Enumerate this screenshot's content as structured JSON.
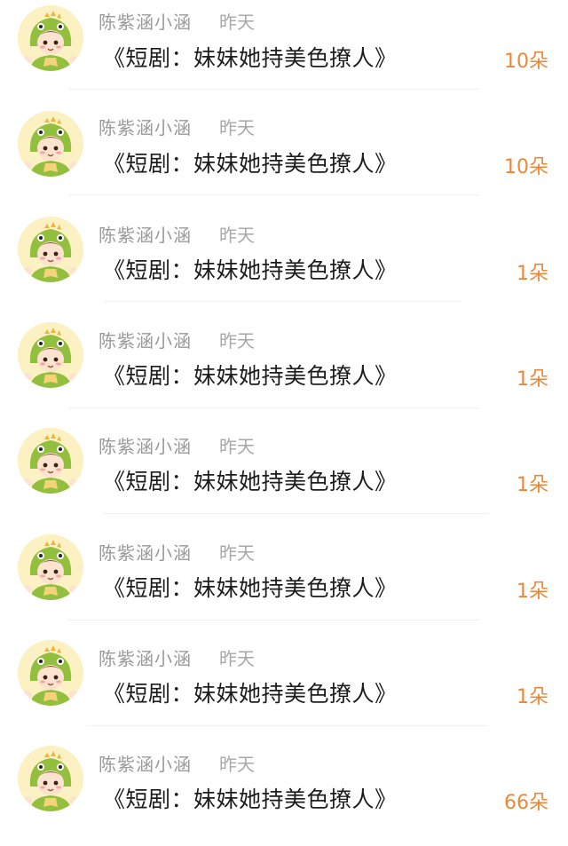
{
  "accent_color": "#e8893a",
  "items": [
    {
      "username": "陈紫涵小涵",
      "time": "昨天",
      "title": "《短剧：妹妹她持美色撩人》",
      "count": "10朵",
      "avatar_icon": "dinosaur-costume-avatar"
    },
    {
      "username": "陈紫涵小涵",
      "time": "昨天",
      "title": "《短剧：妹妹她持美色撩人》",
      "count": "10朵",
      "avatar_icon": "dinosaur-costume-avatar"
    },
    {
      "username": "陈紫涵小涵",
      "time": "昨天",
      "title": "《短剧：妹妹她持美色撩人》",
      "count": "1朵",
      "avatar_icon": "dinosaur-costume-avatar"
    },
    {
      "username": "陈紫涵小涵",
      "time": "昨天",
      "title": "《短剧：妹妹她持美色撩人》",
      "count": "1朵",
      "avatar_icon": "dinosaur-costume-avatar"
    },
    {
      "username": "陈紫涵小涵",
      "time": "昨天",
      "title": "《短剧：妹妹她持美色撩人》",
      "count": "1朵",
      "avatar_icon": "dinosaur-costume-avatar"
    },
    {
      "username": "陈紫涵小涵",
      "time": "昨天",
      "title": "《短剧：妹妹她持美色撩人》",
      "count": "1朵",
      "avatar_icon": "dinosaur-costume-avatar"
    },
    {
      "username": "陈紫涵小涵",
      "time": "昨天",
      "title": "《短剧：妹妹她持美色撩人》",
      "count": "1朵",
      "avatar_icon": "dinosaur-costume-avatar"
    },
    {
      "username": "陈紫涵小涵",
      "time": "昨天",
      "title": "《短剧：妹妹她持美色撩人》",
      "count": "66朵",
      "avatar_icon": "dinosaur-costume-avatar"
    }
  ]
}
